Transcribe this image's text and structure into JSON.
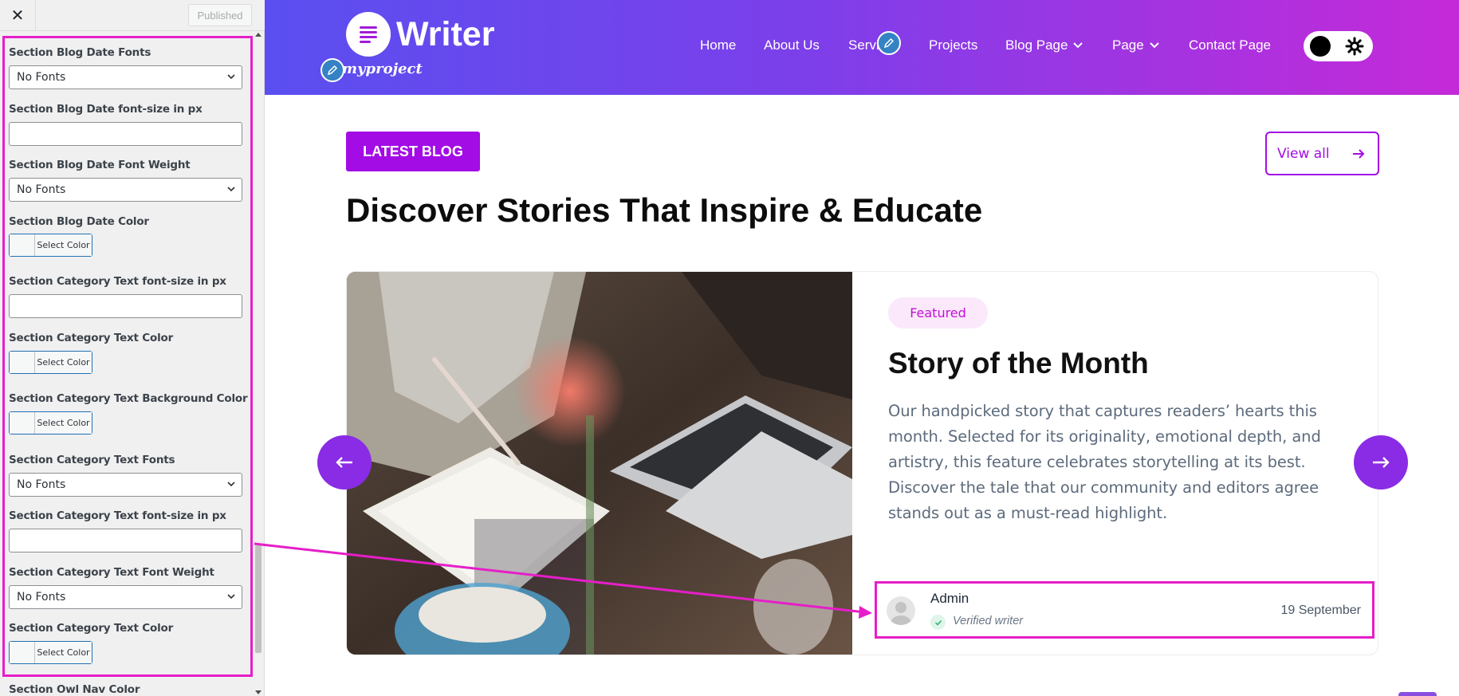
{
  "customizer": {
    "close_label": "✕",
    "publish_label": "Published",
    "controls": [
      {
        "label": "Section Blog Date Fonts",
        "type": "select",
        "value": "No Fonts"
      },
      {
        "label": "Section Blog Date font-size in px",
        "type": "input",
        "value": ""
      },
      {
        "label": "Section Blog Date Font Weight",
        "type": "select",
        "value": "No Fonts"
      },
      {
        "label": "Section Blog Date Color",
        "type": "color",
        "value": "Select Color"
      },
      {
        "label": "Section Category Text font-size in px",
        "type": "input",
        "value": ""
      },
      {
        "label": "Section Category Text Color",
        "type": "color",
        "value": "Select Color"
      },
      {
        "label": "Section Category Text Background Color",
        "type": "color",
        "value": "Select Color"
      },
      {
        "label": "Section Category Text Fonts",
        "type": "select",
        "value": "No Fonts"
      },
      {
        "label": "Section Category Text font-size in px",
        "type": "input",
        "value": ""
      },
      {
        "label": "Section Category Text Font Weight",
        "type": "select",
        "value": "No Fonts"
      },
      {
        "label": "Section Category Text Color",
        "type": "color",
        "value": "Select Color"
      },
      {
        "label": "Section Owl Nav Color",
        "type": "label",
        "value": ""
      }
    ]
  },
  "site": {
    "logo_text": "Writer",
    "tagline": "myproject",
    "nav": [
      "Home",
      "About Us",
      "Servi",
      "Projects",
      "Blog Page",
      "Page",
      "Contact Page"
    ],
    "colors": {
      "accent": "#a30ce5",
      "header_start": "#5a4ff0",
      "header_end": "#c52ad8",
      "highlight": "#e61ec9"
    }
  },
  "section": {
    "tag": "LATEST BLOG",
    "view_all": "View all",
    "heading": "Discover Stories That Inspire & Educate"
  },
  "card": {
    "badge": "Featured",
    "title": "Story of the Month",
    "description": "Our handpicked story that captures readers’ hearts this month. Selected for its originality, emotional depth, and artistry, this feature celebrates storytelling at its best. Discover the tale that our community and editors agree stands out as a must-read highlight.",
    "author": "Admin",
    "author_role": "Verified writer",
    "date": "19 September"
  }
}
